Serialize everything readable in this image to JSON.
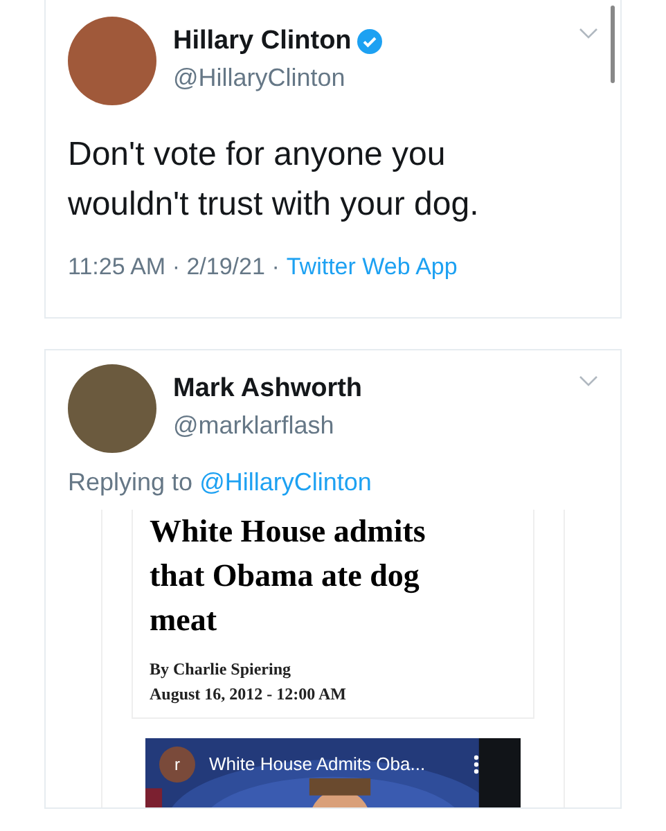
{
  "tweets": [
    {
      "name": "Hillary Clinton",
      "verified": true,
      "handle": "@HillaryClinton",
      "text": "Don't vote for anyone you wouldn't trust with your dog.",
      "time": "11:25 AM",
      "date": "2/19/21",
      "separator": "·",
      "source": "Twitter Web App"
    },
    {
      "name": "Mark Ashworth",
      "verified": false,
      "handle": "@marklarflash",
      "replying_prefix": "Replying to",
      "replying_handle": "@HillaryClinton",
      "article": {
        "headline": "White House admits that Obama ate dog meat",
        "byline": "By Charlie Spiering",
        "date": "August 16, 2012 - 12:00 AM",
        "video": {
          "channel_initial": "r",
          "title": "White House Admits Oba..."
        }
      }
    }
  ]
}
